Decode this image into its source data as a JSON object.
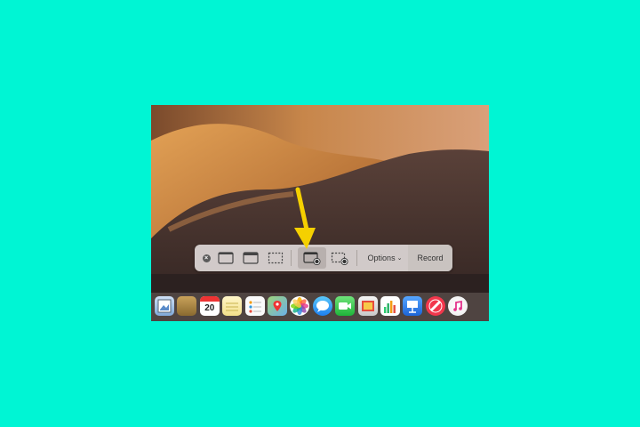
{
  "toolbar": {
    "options_label": "Options",
    "options_chevron": "⌄",
    "record_label": "Record",
    "close_symbol": "×",
    "buttons": [
      {
        "name": "capture-entire-screen-icon",
        "selected": false
      },
      {
        "name": "capture-window-icon",
        "selected": false
      },
      {
        "name": "capture-selected-portion-icon",
        "selected": false
      },
      {
        "name": "record-entire-screen-icon",
        "selected": true
      },
      {
        "name": "record-selected-portion-icon",
        "selected": false
      }
    ]
  },
  "annotation": {
    "color": "#f5d000",
    "points_to": "record-entire-screen-icon"
  },
  "dock": {
    "calendar_day": "20",
    "apps": [
      "preview",
      "notes-book",
      "calendar",
      "notes",
      "reminders",
      "maps",
      "photos",
      "messages",
      "facetime",
      "photo-booth",
      "numbers",
      "keynote",
      "news",
      "itunes"
    ]
  },
  "colors": {
    "background": "#00f5d4",
    "record_bg": "#c8c2c0"
  }
}
